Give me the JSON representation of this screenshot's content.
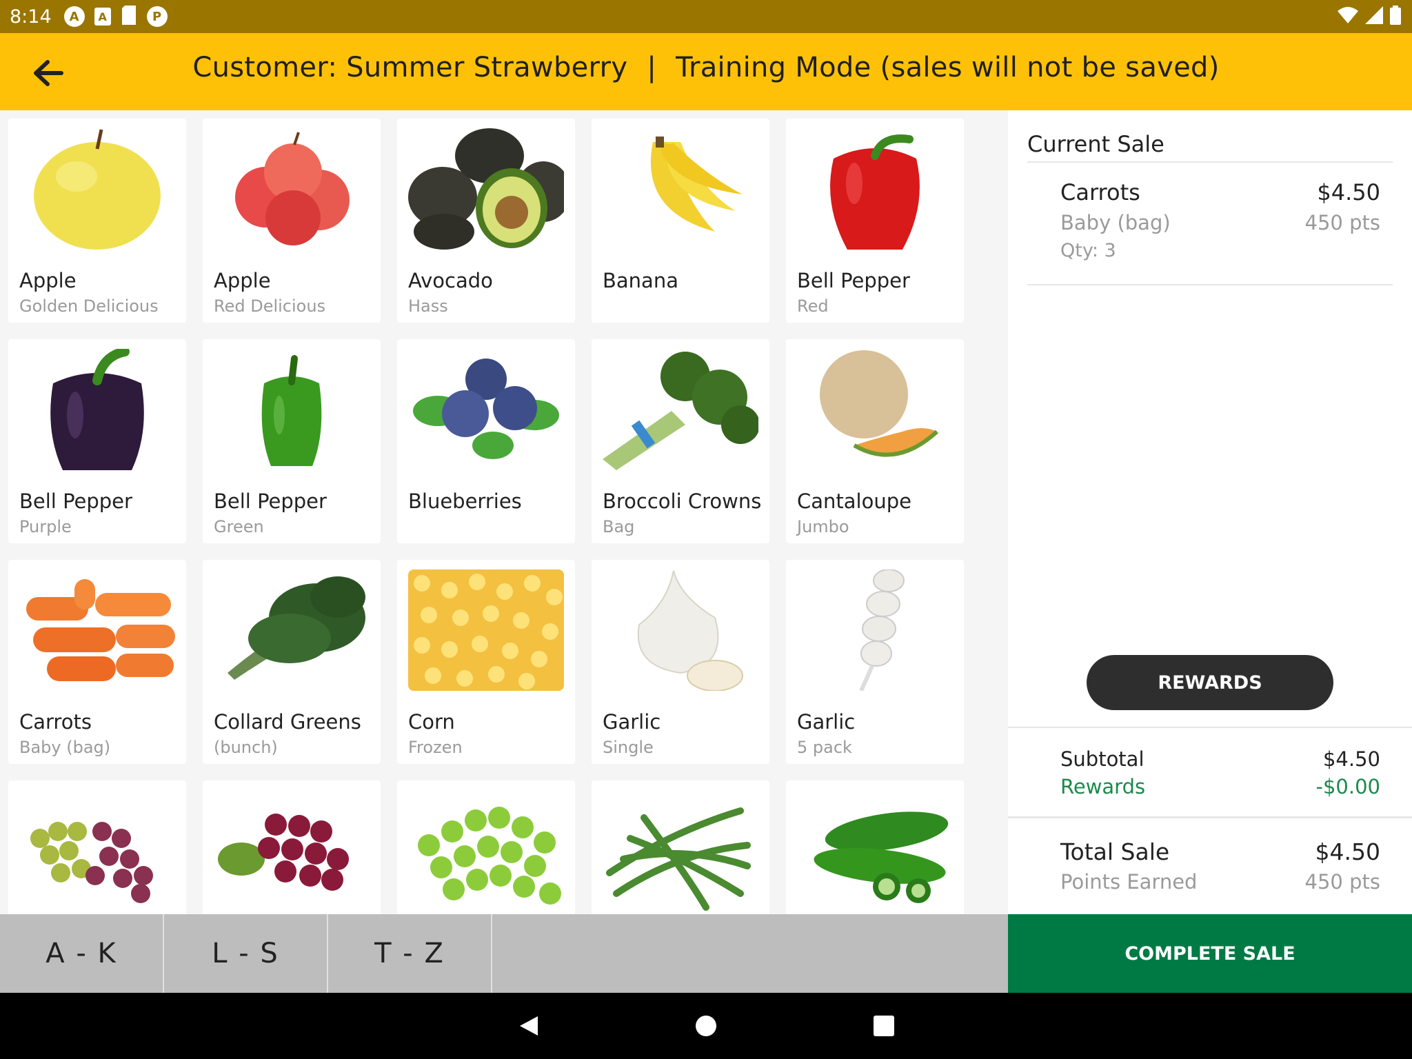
{
  "status_bar": {
    "time": "8:14"
  },
  "header": {
    "customer": "Customer: Summer Strawberry",
    "separator": "|",
    "mode": "Training Mode (sales will not be saved)"
  },
  "products": [
    {
      "name": "Apple",
      "sub": "Golden Delicious",
      "icon": "golden-apple-image"
    },
    {
      "name": "Apple",
      "sub": "Red Delicious",
      "icon": "red-apple-image"
    },
    {
      "name": "Avocado",
      "sub": "Hass",
      "icon": "avocado-image"
    },
    {
      "name": "Banana",
      "sub": "",
      "icon": "banana-image"
    },
    {
      "name": "Bell Pepper",
      "sub": "Red",
      "icon": "red-pepper-image"
    },
    {
      "name": "Bell Pepper",
      "sub": "Purple",
      "icon": "purple-pepper-image"
    },
    {
      "name": "Bell Pepper",
      "sub": "Green",
      "icon": "green-pepper-image"
    },
    {
      "name": "Blueberries",
      "sub": "",
      "icon": "blueberries-image"
    },
    {
      "name": "Broccoli Crowns",
      "sub": "Bag",
      "icon": "broccoli-image"
    },
    {
      "name": "Cantaloupe",
      "sub": "Jumbo",
      "icon": "cantaloupe-image"
    },
    {
      "name": "Carrots",
      "sub": "Baby (bag)",
      "icon": "carrots-image"
    },
    {
      "name": "Collard Greens",
      "sub": "(bunch)",
      "icon": "collard-greens-image"
    },
    {
      "name": "Corn",
      "sub": "Frozen",
      "icon": "corn-image"
    },
    {
      "name": "Garlic",
      "sub": "Single",
      "icon": "garlic-image"
    },
    {
      "name": "Garlic",
      "sub": "5 pack",
      "icon": "garlic-pack-image"
    },
    {
      "name": "",
      "sub": "",
      "icon": "mixed-grapes-image"
    },
    {
      "name": "",
      "sub": "",
      "icon": "red-grapes-image"
    },
    {
      "name": "",
      "sub": "",
      "icon": "green-grapes-image"
    },
    {
      "name": "",
      "sub": "",
      "icon": "green-beans-image"
    },
    {
      "name": "",
      "sub": "",
      "icon": "jalapeno-image"
    }
  ],
  "sale": {
    "heading": "Current Sale",
    "items": [
      {
        "name": "Carrots",
        "price": "$4.50",
        "variant": "Baby (bag)",
        "points": "450 pts",
        "qty": "Qty: 3"
      }
    ],
    "rewards_button": "REWARDS",
    "subtotal_label": "Subtotal",
    "subtotal_value": "$4.50",
    "rewards_label": "Rewards",
    "rewards_value": "-$0.00",
    "total_label": "Total Sale",
    "total_value": "$4.50",
    "points_label": "Points Earned",
    "points_value": "450 pts",
    "complete_button": "COMPLETE SALE"
  },
  "tabs": [
    "A - K",
    "L - S",
    "T - Z"
  ],
  "colors": {
    "header": "#ffc107",
    "status_bar": "#9a7500",
    "complete": "#007a45",
    "rewards_text": "#1b8a4c"
  }
}
